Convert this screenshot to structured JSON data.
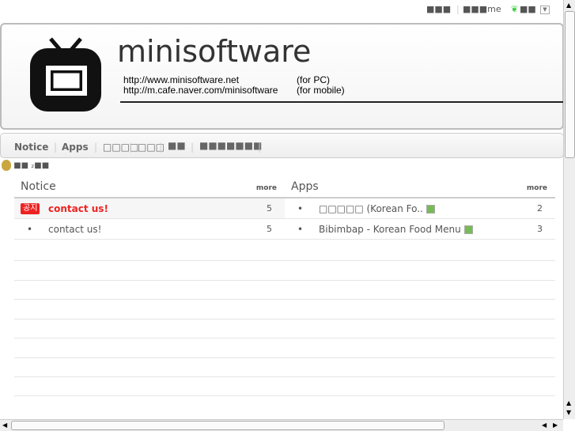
{
  "topbar": {
    "item1": "■■■",
    "item2": "■■■me",
    "item3": "■■"
  },
  "header": {
    "title": "minisoftware",
    "url_pc": "http://www.minisoftware.net",
    "url_pc_note": "(for PC)",
    "url_mobile": "http://m.cafe.naver.com/minisoftware",
    "url_mobile_note": "(for mobile)"
  },
  "nav": [
    "Notice",
    "Apps",
    "□□□□",
    "□□□",
    "■■",
    "■■■■■■■"
  ],
  "crumb": "■■ ₂■■",
  "notice": {
    "title": "Notice",
    "more": "more",
    "items": [
      {
        "badge": "공지",
        "title": "contact us!",
        "count": "5",
        "hot": true
      },
      {
        "bullet": "•",
        "title": "contact us!",
        "count": "5"
      }
    ]
  },
  "apps": {
    "title": "Apps",
    "more": "more",
    "items": [
      {
        "bullet": "•",
        "title": "□□□□□ (Korean Fo..",
        "count": "2"
      },
      {
        "bullet": "•",
        "title": "Bibimbap - Korean Food Menu",
        "count": "3"
      }
    ]
  }
}
